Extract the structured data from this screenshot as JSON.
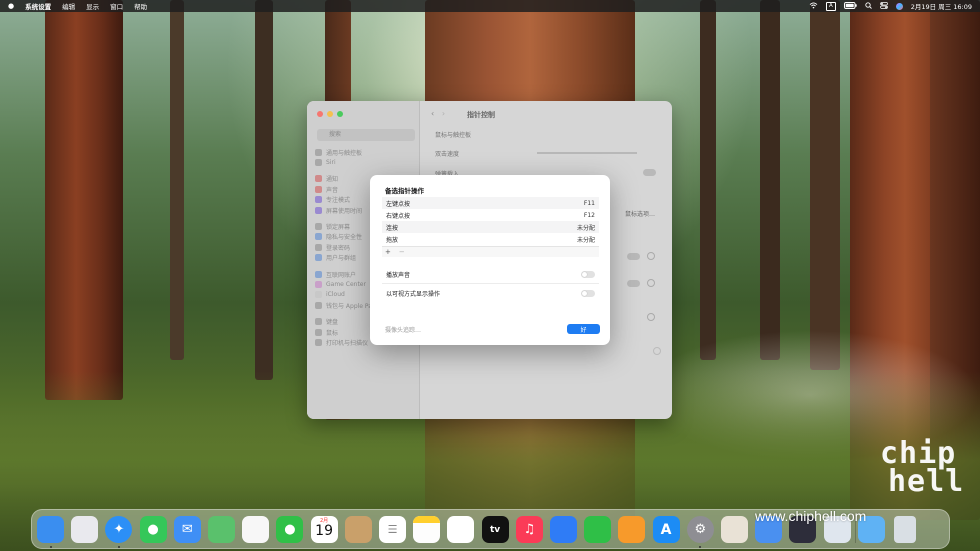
{
  "menubar": {
    "apple_icon": "apple-icon",
    "app_name": "系统设置",
    "menus": [
      "编辑",
      "显示",
      "窗口",
      "帮助"
    ],
    "input_method": "A",
    "datetime": "2月19日 周三 16:09"
  },
  "settings_window": {
    "search_placeholder": "搜索",
    "sidebar_items": [
      "通用与触控板",
      "Siri",
      "通知",
      "声音",
      "专注模式",
      "屏幕使用时间",
      "锁定屏幕",
      "隐私与安全性",
      "登录密码",
      "用户与群组",
      "互联网账户",
      "Game Center",
      "iCloud",
      "钱包与 Apple Pay",
      "键盘",
      "鼠标",
      "打印机与扫描仪"
    ],
    "title": "指针控制",
    "section_header": "鼠标与触控板",
    "row_labels": [
      "双击速度",
      "弹簧载入"
    ],
    "options_button": "鼠标选项…"
  },
  "dialog": {
    "title": "备选指针操作",
    "actions": [
      {
        "name": "左键点按",
        "value": "F11"
      },
      {
        "name": "右键点按",
        "value": "F12"
      },
      {
        "name": "连按",
        "value": "未分配"
      },
      {
        "name": "拖放",
        "value": "未分配"
      }
    ],
    "add_symbol": "+",
    "remove_symbol": "−",
    "settings": [
      {
        "label": "播放声音",
        "on": false
      },
      {
        "label": "以可视方式显示操作",
        "on": false
      }
    ],
    "camera_link": "摄像头追踪…",
    "ok_label": "好"
  },
  "dock": {
    "apps": [
      {
        "name": "finder",
        "color": "#3a8ef0"
      },
      {
        "name": "launchpad",
        "color": "#e9e9ee"
      },
      {
        "name": "safari",
        "color": "#2c8ff6"
      },
      {
        "name": "messages",
        "color": "#35c759"
      },
      {
        "name": "mail",
        "color": "#3f8ff5"
      },
      {
        "name": "maps",
        "color": "#5ac16c"
      },
      {
        "name": "photos",
        "color": "#f7f7f7"
      },
      {
        "name": "facetime",
        "color": "#30c048"
      },
      {
        "name": "calendar",
        "color": "#ffffff"
      },
      {
        "name": "contacts",
        "color": "#c9a06a"
      },
      {
        "name": "reminders",
        "color": "#ffffff"
      },
      {
        "name": "notes",
        "color": "#ffd84a"
      },
      {
        "name": "freeform",
        "color": "#ffffff"
      },
      {
        "name": "tv",
        "color": "#111111"
      },
      {
        "name": "music",
        "color": "#fb3b57"
      },
      {
        "name": "keynote",
        "color": "#2f7cf6"
      },
      {
        "name": "numbers",
        "color": "#2fbf47"
      },
      {
        "name": "pages",
        "color": "#f79a2b"
      },
      {
        "name": "app-store",
        "color": "#1c8cf5"
      },
      {
        "name": "system-settings",
        "color": "#8e8e93"
      },
      {
        "name": "iphone-mirroring",
        "color": "#e9e2d6"
      },
      {
        "name": "xcode",
        "color": "#4a90f0"
      },
      {
        "name": "quicktime",
        "color": "#2d2d3a"
      },
      {
        "name": "preview",
        "color": "#dfe6ee"
      },
      {
        "name": "downloads-folder",
        "color": "#5fb2f4"
      },
      {
        "name": "trash",
        "color": "#d9dfe4"
      }
    ],
    "calendar_month": "2月",
    "calendar_day": "19",
    "tv_label": "tv"
  },
  "watermark": {
    "url": "www.chiphell.com",
    "logo_line1": "chip",
    "logo_line2": "hell"
  }
}
